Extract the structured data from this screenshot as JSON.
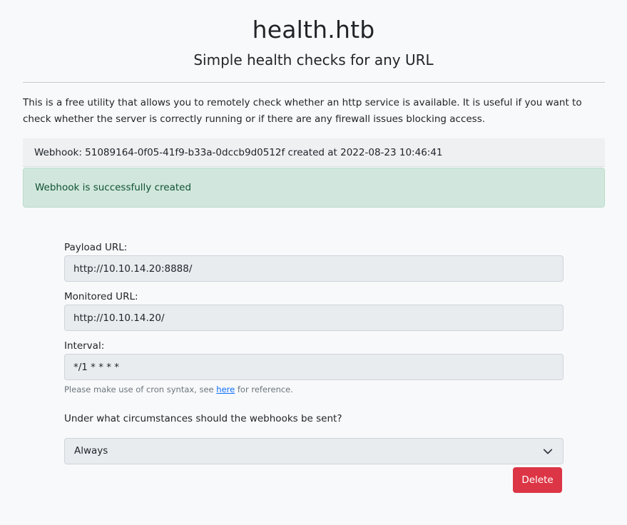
{
  "header": {
    "title": "health.htb",
    "subtitle": "Simple health checks for any URL"
  },
  "intro": {
    "text": "This is a free utility that allows you to remotely check whether an http service is available. It is useful if you want to check whether the server is correctly running or if there are any firewall issues blocking access."
  },
  "webhook": {
    "info": "Webhook: 51089164-0f05-41f9-b33a-0dccb9d0512f created at 2022-08-23 10:46:41"
  },
  "alert": {
    "message": "Webhook is successfully created"
  },
  "form": {
    "payload_label": "Payload URL:",
    "payload_value": "http://10.10.14.20:8888/",
    "monitored_label": "Monitored URL:",
    "monitored_value": "http://10.10.14.20/",
    "interval_label": "Interval:",
    "interval_value": "*/1 * * * *",
    "help_prefix": "Please make use of cron syntax, see ",
    "help_link": "here",
    "help_suffix": " for reference.",
    "question": "Under what circumstances should the webhooks be sent?",
    "send_option": "Always",
    "delete_label": "Delete"
  },
  "colors": {
    "background": "#f8f9fa",
    "success_bg": "#d1e7dd",
    "success_text": "#0f5132",
    "danger": "#dc3545",
    "link": "#0d6efd"
  }
}
